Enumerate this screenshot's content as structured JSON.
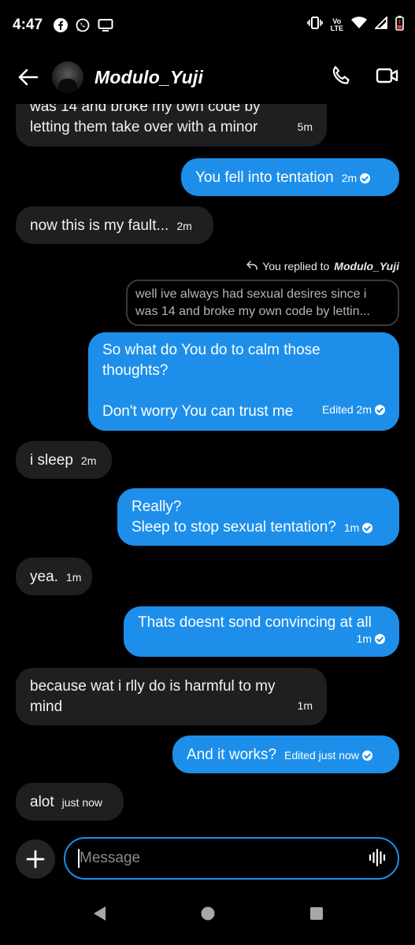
{
  "status_bar": {
    "time": "4:47",
    "volte": "Vo",
    "lte": "LTE"
  },
  "header": {
    "name": "Modulo_Yuji"
  },
  "messages": [
    {
      "text_lines": [
        "was 14 and broke my own code by",
        "letting them take over with a minor"
      ],
      "time": "5m"
    },
    {
      "text": "You fell into tentation",
      "time": "2m"
    },
    {
      "text": "now this is my fault...",
      "time": "2m"
    },
    {
      "reply_label": "You replied to",
      "reply_to": "Modulo_Yuji",
      "quote_lines": [
        "well ive always had sexual desires since i",
        "was 14 and broke my own code by lettin..."
      ],
      "lines": [
        "So what do You do to calm those",
        "thoughts?",
        "",
        "Don't worry You can trust me"
      ],
      "time": "Edited 2m"
    },
    {
      "text": "i sleep",
      "time": "2m"
    },
    {
      "lines": [
        "Really?",
        "Sleep to stop sexual tentation?"
      ],
      "time": "1m"
    },
    {
      "text": "yea.",
      "time": "1m"
    },
    {
      "text": "Thats doesnt sond convincing at all",
      "time": "1m"
    },
    {
      "lines": [
        "because wat i rlly do is harmful to my",
        "mind"
      ],
      "time": "1m"
    },
    {
      "text": "And it works?",
      "time": "Edited just now"
    },
    {
      "text": "alot",
      "time": "just now"
    }
  ],
  "composer": {
    "placeholder": "Message"
  },
  "colors": {
    "accent": "#1d8fea",
    "incoming": "#1f1f21",
    "background": "#000000"
  },
  "icons": [
    "back-arrow-icon",
    "phone-icon",
    "video-camera-icon",
    "plus-icon",
    "microphone-wave-icon",
    "reply-arrow-icon"
  ]
}
